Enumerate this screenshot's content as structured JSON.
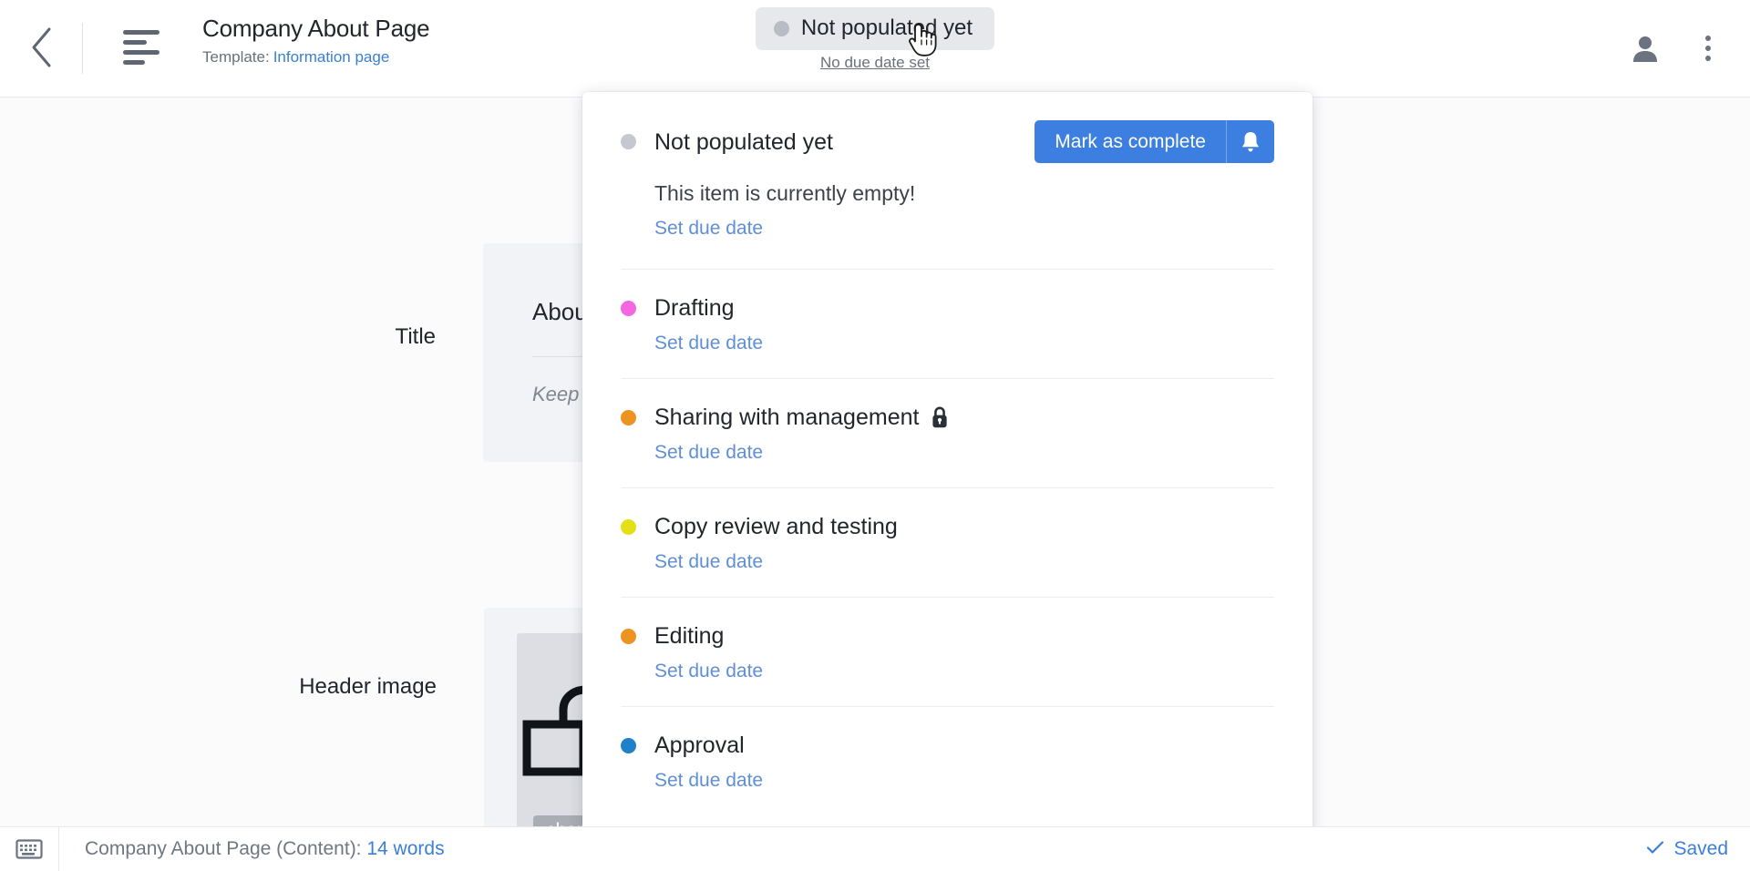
{
  "header": {
    "back_icon": "chevron-left-icon",
    "doc_icon": "document-lines-icon",
    "page_title": "Company About Page",
    "template_prefix": "Template:",
    "template_name": "Information page",
    "avatar_icon": "person-icon",
    "menu_icon": "kebab-menu-icon",
    "status_pill": {
      "label": "Not populated yet",
      "dot_color": "#b8bcc4"
    },
    "due_date_text": "No due date set"
  },
  "form": {
    "title_field": {
      "label": "Title",
      "value": "About u",
      "hint": "Keep this"
    },
    "image_field": {
      "label": "Header image",
      "thumbnail_caption": "chart.p",
      "thumbnail_icon": "unlock-outline-icon"
    }
  },
  "panel": {
    "current": {
      "status_name": "Not populated yet",
      "dot_color": "#c5c8ce",
      "empty_message": "This item is currently empty!",
      "set_due_date": "Set due date",
      "complete_button": "Mark as complete",
      "bell_icon": "bell-icon"
    },
    "tasks": [
      {
        "name": "Drafting",
        "dot_color": "#f368e0",
        "set_due_date": "Set due date",
        "locked": false
      },
      {
        "name": "Sharing with management",
        "dot_color": "#ee9321",
        "set_due_date": "Set due date",
        "locked": true,
        "lock_icon": "lock-icon"
      },
      {
        "name": "Copy review and testing",
        "dot_color": "#e3e017",
        "set_due_date": "Set due date",
        "locked": false
      },
      {
        "name": "Editing",
        "dot_color": "#ee9321",
        "set_due_date": "Set due date",
        "locked": false
      },
      {
        "name": "Approval",
        "dot_color": "#1e81c9",
        "set_due_date": "Set due date",
        "locked": false
      }
    ]
  },
  "statusbar": {
    "keyboard_icon": "keyboard-icon",
    "word_count_prefix": "Company About Page (Content):",
    "word_count": "14 words",
    "saved_label": "Saved",
    "check_icon": "check-icon"
  },
  "colors": {
    "accent_blue": "#3c7fe0",
    "link_blue": "#3b7fd4",
    "panel_bg": "#ffffff",
    "content_bg": "#fbfbfc"
  }
}
